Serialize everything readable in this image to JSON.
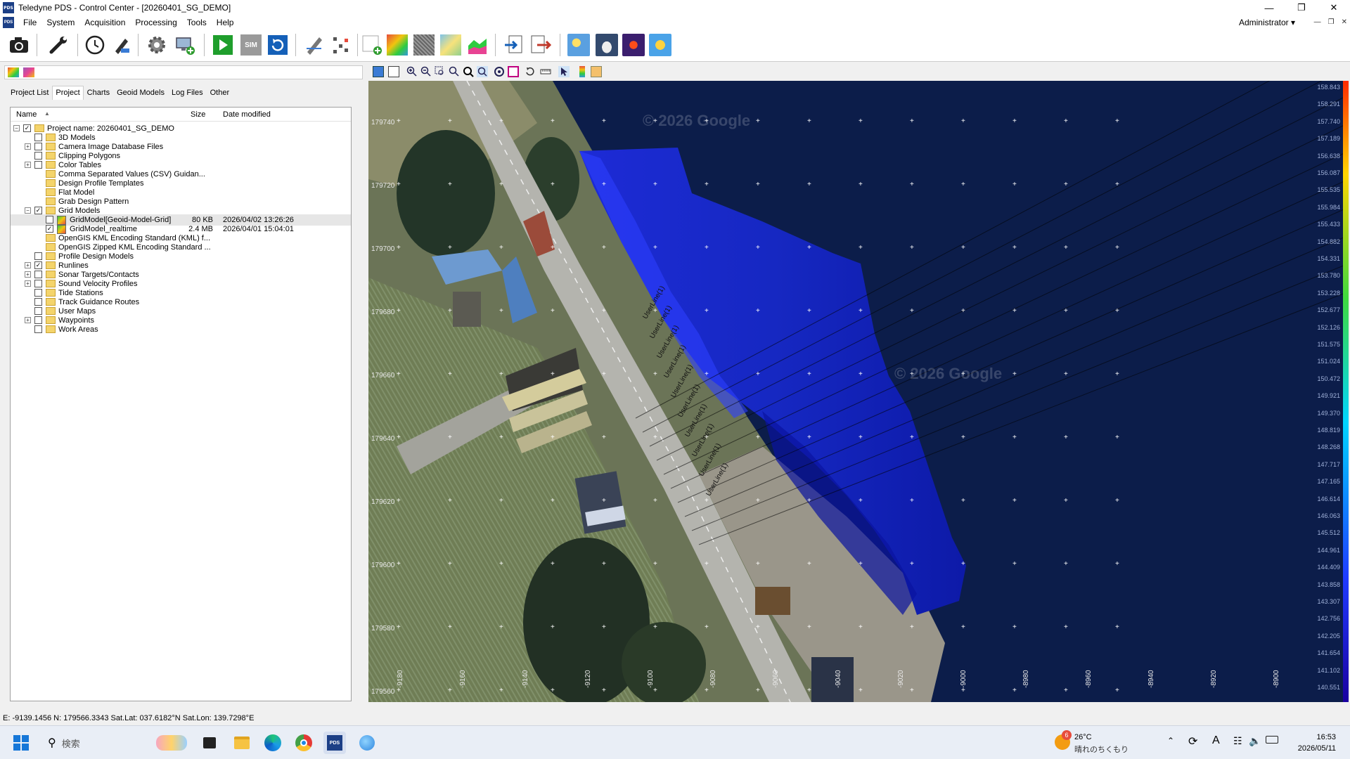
{
  "window": {
    "title": "Teledyne PDS - Control Center - [20260401_SG_DEMO]",
    "app_icon": "PDS"
  },
  "menu": [
    "File",
    "System",
    "Acquisition",
    "Processing",
    "Tools",
    "Help"
  ],
  "user": "Administrator",
  "toolbar_icons": [
    "camera-icon",
    "wrench-icon",
    "clock-icon",
    "pen-tool-icon",
    "gear-icon",
    "monitor-add-icon",
    "play-icon",
    "sim-icon",
    "refresh-icon",
    "edit-tool-icon",
    "points-icon",
    "add-grid-icon",
    "color-grid-icon",
    "texture-icon",
    "map-icon",
    "profile-icon",
    "import-icon",
    "export-icon",
    "weather-sun-icon",
    "weather-cloud-icon",
    "weather-sunset-icon",
    "weather-sunny-icon"
  ],
  "toolbar_labels": {
    "sim": "SIM"
  },
  "left_tabs": [
    "Project List",
    "Project",
    "Charts",
    "Geoid Models",
    "Log Files",
    "Other"
  ],
  "tree_columns": {
    "name": "Name",
    "size": "Size",
    "date": "Date modified"
  },
  "tree": [
    {
      "label": "Project name: 20260401_SG_DEMO",
      "level": 0,
      "expander": "−",
      "checked": true,
      "icon": "folder"
    },
    {
      "label": "3D Models",
      "level": 1,
      "expander": "",
      "checked": false,
      "icon": "folder"
    },
    {
      "label": "Camera Image Database Files",
      "level": 1,
      "expander": "+",
      "checked": false,
      "icon": "folder"
    },
    {
      "label": "Clipping Polygons",
      "level": 1,
      "expander": "",
      "checked": false,
      "icon": "folder"
    },
    {
      "label": "Color Tables",
      "level": 1,
      "expander": "+",
      "checked": false,
      "icon": "folder"
    },
    {
      "label": "Comma Separated Values (CSV) Guidan...",
      "level": 1,
      "expander": "",
      "checked": false,
      "icon": "folder",
      "nobox": true
    },
    {
      "label": "Design Profile Templates",
      "level": 1,
      "expander": "",
      "checked": false,
      "icon": "folder",
      "nobox": true
    },
    {
      "label": "Flat Model",
      "level": 1,
      "expander": "",
      "checked": false,
      "icon": "folder",
      "nobox": true
    },
    {
      "label": "Grab Design Pattern",
      "level": 1,
      "expander": "",
      "checked": false,
      "icon": "folder",
      "nobox": true
    },
    {
      "label": "Grid Models",
      "level": 1,
      "expander": "−",
      "checked": true,
      "icon": "folder"
    },
    {
      "label": "GridModel[Geoid-Model-Grid]",
      "level": 2,
      "expander": "",
      "checked": false,
      "icon": "grid",
      "size": "80 KB",
      "date": "2026/04/02 13:26:26",
      "selected": true
    },
    {
      "label": "GridModel_realtime",
      "level": 2,
      "expander": "",
      "checked": true,
      "icon": "grid",
      "size": "2.4 MB",
      "date": "2026/04/01 15:04:01"
    },
    {
      "label": "OpenGIS KML Encoding Standard (KML) f...",
      "level": 1,
      "expander": "",
      "checked": false,
      "icon": "folder",
      "nobox": true
    },
    {
      "label": "OpenGIS Zipped KML Encoding Standard ...",
      "level": 1,
      "expander": "",
      "checked": false,
      "icon": "folder",
      "nobox": true
    },
    {
      "label": "Profile Design Models",
      "level": 1,
      "expander": "",
      "checked": false,
      "icon": "folder"
    },
    {
      "label": "Runlines",
      "level": 1,
      "expander": "+",
      "checked": true,
      "icon": "folder"
    },
    {
      "label": "Sonar Targets/Contacts",
      "level": 1,
      "expander": "+",
      "checked": false,
      "icon": "folder"
    },
    {
      "label": "Sound Velocity Profiles",
      "level": 1,
      "expander": "+",
      "checked": false,
      "icon": "folder"
    },
    {
      "label": "Tide Stations",
      "level": 1,
      "expander": "",
      "checked": false,
      "icon": "folder"
    },
    {
      "label": "Track Guidance Routes",
      "level": 1,
      "expander": "",
      "checked": false,
      "icon": "folder"
    },
    {
      "label": "User Maps",
      "level": 1,
      "expander": "",
      "checked": false,
      "icon": "folder"
    },
    {
      "label": "Waypoints",
      "level": 1,
      "expander": "+",
      "checked": false,
      "icon": "folder"
    },
    {
      "label": "Work Areas",
      "level": 1,
      "expander": "",
      "checked": false,
      "icon": "folder"
    }
  ],
  "map": {
    "watermark": "© 2026 Google",
    "northing_labels": [
      "179740",
      "179720",
      "179700",
      "179680",
      "179660",
      "179640",
      "179620",
      "179600",
      "179580",
      "179560"
    ],
    "easting_labels": [
      "-9180",
      "-9160",
      "-9140",
      "-9120",
      "-9100",
      "-9080",
      "-9060",
      "-9040",
      "-9020",
      "-9000",
      "-8980",
      "-8960",
      "-8940",
      "-8920",
      "-8900"
    ],
    "color_scale": [
      "158.843",
      "158.291",
      "157.740",
      "157.189",
      "156.638",
      "156.087",
      "155.535",
      "155.984",
      "155.433",
      "154.882",
      "154.331",
      "153.780",
      "153.228",
      "152.677",
      "152.126",
      "151.575",
      "151.024",
      "150.472",
      "149.921",
      "149.370",
      "148.819",
      "148.268",
      "147.717",
      "147.165",
      "146.614",
      "146.063",
      "145.512",
      "144.961",
      "144.409",
      "143.858",
      "143.307",
      "142.756",
      "142.205",
      "141.654",
      "141.102",
      "140.551"
    ],
    "runline_label": "UserLine(1)"
  },
  "status_bar": "E: -9139.1456 N: 179566.3343 Sat.Lat: 037.6182°N Sat.Lon: 139.7298°E",
  "taskbar": {
    "search_placeholder": "検索",
    "weather_temp": "26°C",
    "weather_text": "晴れのちくもり",
    "weather_badge": "6",
    "time": "16:53",
    "date": "2026/05/11",
    "ime": "A",
    "pds_label": "PDS"
  }
}
